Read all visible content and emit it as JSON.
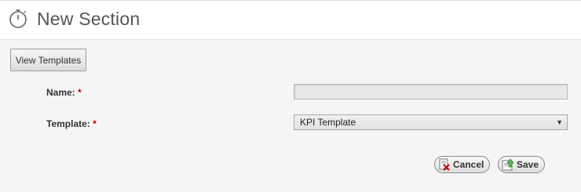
{
  "header": {
    "title": "New Section",
    "icon": "stopwatch-icon"
  },
  "toolbar": {
    "view_templates_label": "View Templates"
  },
  "form": {
    "name_label": "Name:",
    "template_label": "Template:",
    "required_marker": "*",
    "name_value": "",
    "template_selected": "KPI Template"
  },
  "actions": {
    "cancel_label": "Cancel",
    "save_label": "Save",
    "cancel_icon": "cancel-icon",
    "save_icon": "save-icon"
  },
  "colors": {
    "required": "#cc0000",
    "page_bg": "#f5f5f5",
    "header_bg": "#ffffff"
  }
}
